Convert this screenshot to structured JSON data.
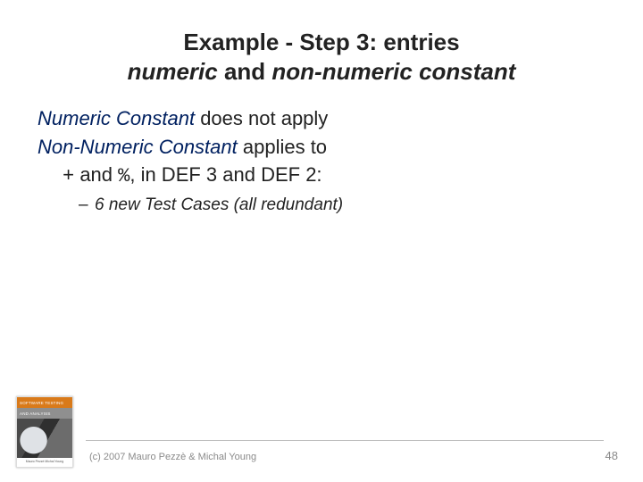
{
  "title": {
    "line1_prefix": "Example - Step 3: entries",
    "line2_italic1": "numeric",
    "line2_mid": " and ",
    "line2_italic2": "non-numeric constant"
  },
  "body": {
    "p1_italic": "Numeric Constant",
    "p1_rest": " does not apply",
    "p2_italic": "Non-Numeric Constant",
    "p2_rest": " applies to",
    "p3_code1": "+",
    "p3_mid1": " and ",
    "p3_code2": "%",
    "p3_rest": ", in DEF 3 and DEF 2:",
    "sub1": "6 new Test Cases (all redundant)"
  },
  "cover": {
    "top_text": "SOFTWARE TESTING",
    "sub_text": "AND ANALYSIS",
    "authors": "Mauro Pezzè   Michal Young"
  },
  "footer": {
    "copyright": "(c) 2007 Mauro Pezzè & Michal Young",
    "page": "48"
  }
}
